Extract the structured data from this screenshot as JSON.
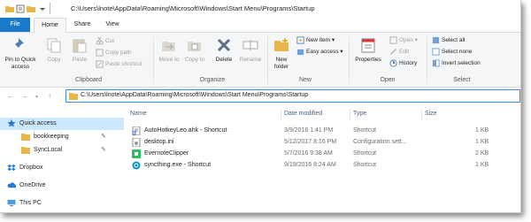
{
  "window": {
    "title": "C:\\Users\\lnote\\AppData\\Roaming\\Microsoft\\Windows\\Start Menu\\Programs\\Startup"
  },
  "tabs": {
    "file": "File",
    "home": "Home",
    "share": "Share",
    "view": "View"
  },
  "ribbon": {
    "clipboard": {
      "pin": "Pin to Quick access",
      "copy": "Copy",
      "paste": "Paste",
      "cut": "Cut",
      "copy_path": "Copy path",
      "paste_shortcut": "Paste shortcut",
      "label": "Clipboard"
    },
    "organize": {
      "move_to": "Move to",
      "copy_to": "Copy to",
      "delete": "Delete",
      "rename": "Rename",
      "label": "Organize"
    },
    "new": {
      "new_folder": "New folder",
      "new_item": "New item",
      "easy_access": "Easy access",
      "label": "New"
    },
    "open": {
      "properties": "Properties",
      "open": "Open",
      "edit": "Edit",
      "history": "History",
      "label": "Open"
    },
    "select": {
      "select_all": "Select all",
      "select_none": "Select none",
      "invert": "Invert selection",
      "label": "Select"
    }
  },
  "address": {
    "path": "C:\\Users\\lnote\\AppData\\Roaming\\Microsoft\\Windows\\Start Menu\\Programs\\Startup"
  },
  "nav_pane": {
    "items": [
      {
        "label": "Quick access"
      },
      {
        "label": "bookkeeping"
      },
      {
        "label": "SyncLocal"
      },
      {
        "label": "Dropbox"
      },
      {
        "label": "OneDrive"
      },
      {
        "label": "This PC"
      }
    ]
  },
  "columns": {
    "name": "Name",
    "date": "Date modified",
    "type": "Type",
    "size": "Size"
  },
  "files": [
    {
      "name": "AutoHotkeyLeo.ahk - Shortcut",
      "date": "3/9/2016 1:41 PM",
      "type": "Shortcut",
      "size": "1 KB"
    },
    {
      "name": "desktop.ini",
      "date": "5/12/2017 8:16 PM",
      "type": "Configuration sett...",
      "size": "1 KB"
    },
    {
      "name": "EvernoteClipper",
      "date": "5/7/2016 9:38 AM",
      "type": "Shortcut",
      "size": "2 KB"
    },
    {
      "name": "syncthing.exe - Shortcut",
      "date": "9/19/2016 8:24 AM",
      "type": "Shortcut",
      "size": "1 KB"
    }
  ],
  "colors": {
    "accent": "#1979ca",
    "folder": "#e8b84a",
    "selected": "#cce8ff"
  }
}
